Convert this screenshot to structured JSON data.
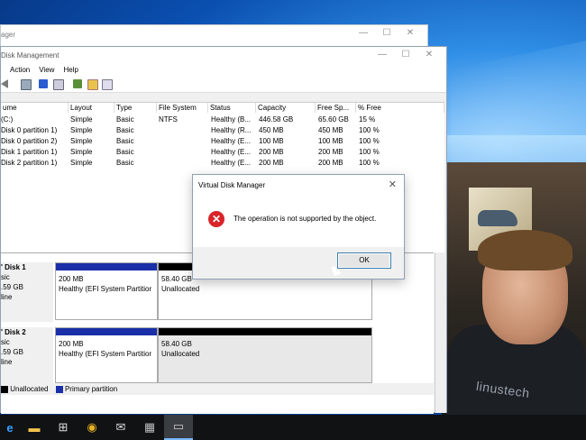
{
  "back_window": {
    "title": "ager"
  },
  "main_window": {
    "title": "Disk Management",
    "menu": [
      "Action",
      "View",
      "Help"
    ]
  },
  "caption_buttons": {
    "minimize": "—",
    "maximize": "☐",
    "close": "✕"
  },
  "volume_table": {
    "columns": [
      "ume",
      "Layout",
      "Type",
      "File System",
      "Status",
      "Capacity",
      "Free Sp...",
      "% Free"
    ],
    "rows": [
      [
        "(C:)",
        "Simple",
        "Basic",
        "NTFS",
        "Healthy (B...",
        "446.58 GB",
        "65.60 GB",
        "15 %"
      ],
      [
        "Disk 0 partition 1)",
        "Simple",
        "Basic",
        "",
        "Healthy (R...",
        "450 MB",
        "450 MB",
        "100 %"
      ],
      [
        "Disk 0 partition 2)",
        "Simple",
        "Basic",
        "",
        "Healthy (E...",
        "100 MB",
        "100 MB",
        "100 %"
      ],
      [
        "Disk 1 partition 1)",
        "Simple",
        "Basic",
        "",
        "Healthy (E...",
        "200 MB",
        "200 MB",
        "100 %"
      ],
      [
        "Disk 2 partition 1)",
        "Simple",
        "Basic",
        "",
        "Healthy (E...",
        "200 MB",
        "200 MB",
        "100 %"
      ]
    ]
  },
  "disks": [
    {
      "name": "' Disk 1",
      "type": "sic",
      "size": ".59 GB",
      "status": "line",
      "p1_size": "200 MB",
      "p1_status": "Healthy (EFI System Partitior",
      "p2_size": "58.40 GB",
      "p2_status": "Unallocated"
    },
    {
      "name": "' Disk 2",
      "type": "sic",
      "size": ".59 GB",
      "status": "line",
      "p1_size": "200 MB",
      "p1_status": "Healthy (EFI System Partitior",
      "p2_size": "58.40 GB",
      "p2_status": "Unallocated"
    }
  ],
  "legend": {
    "unallocated": "Unallocated",
    "primary": "Primary partition"
  },
  "dialog": {
    "title": "Virtual Disk Manager",
    "message": "The operation is not supported by the object.",
    "ok_label": "OK",
    "close_glyph": "✕",
    "icon_glyph": "✕"
  },
  "video_overlay": {
    "shirt_text": "linustech"
  },
  "taskbar": {
    "items": [
      {
        "name": "edge-icon",
        "glyph": "e"
      },
      {
        "name": "file-explorer-icon",
        "glyph": "▬"
      },
      {
        "name": "store-icon",
        "glyph": "⊞"
      },
      {
        "name": "chrome-icon",
        "glyph": "◉"
      },
      {
        "name": "mail-icon",
        "glyph": "✉"
      },
      {
        "name": "server-manager-icon",
        "glyph": "▦"
      },
      {
        "name": "disk-management-icon",
        "glyph": "▭"
      }
    ]
  },
  "colors": {
    "primary_partition": "#1a2fa8",
    "unallocated": "#000000",
    "error": "#d9252a",
    "accent": "#3c7fb1"
  }
}
